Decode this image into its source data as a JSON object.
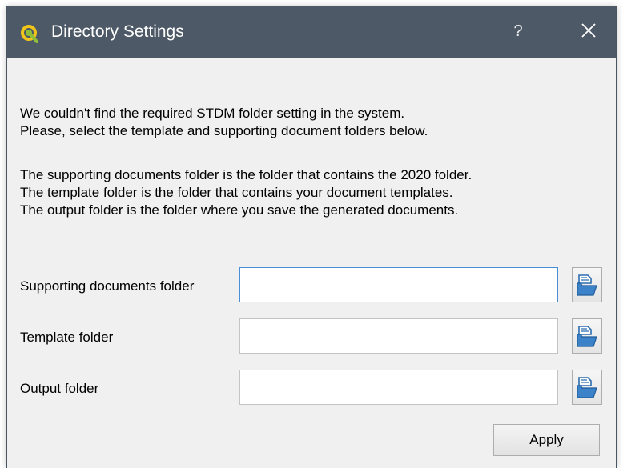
{
  "window": {
    "title": "Directory Settings",
    "help_label": "?",
    "app_icon": "qgis-icon",
    "titlebar_color": "#4d5966"
  },
  "message": {
    "line1": "We couldn't find the required STDM folder setting in the system.",
    "line2": "Please, select the template and supporting document folders below.",
    "line3": "The supporting documents folder is the folder that contains the 2020 folder.",
    "line4": "The template folder is the folder that contains your document templates.",
    "line5": "The output folder is the folder where you save the generated documents."
  },
  "fields": {
    "supporting": {
      "label": "Supporting documents folder",
      "value": "",
      "focused": true
    },
    "template": {
      "label": "Template folder",
      "value": ""
    },
    "output": {
      "label": "Output folder",
      "value": ""
    }
  },
  "browse_icon": "folder-open-icon",
  "apply_label": "Apply"
}
